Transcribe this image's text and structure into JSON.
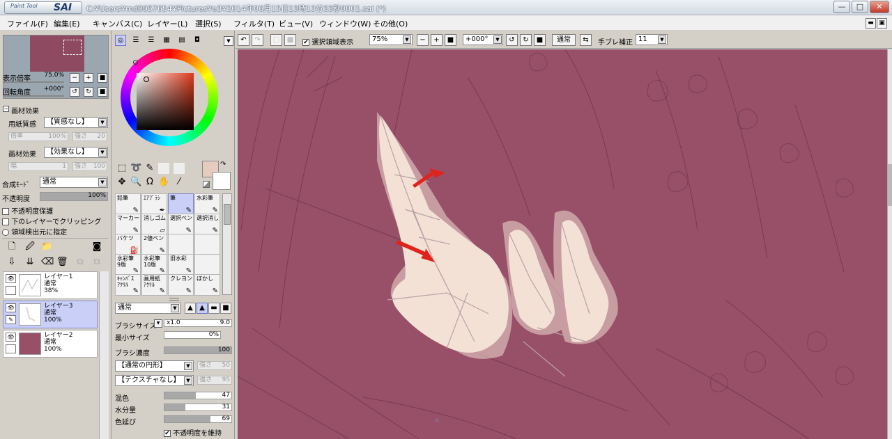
{
  "titlebar": {
    "logo_small": "Paint Tool",
    "logo_big": "SAI",
    "path": "C:¥Users¥md0057654¥Pictures¥e3¥2014年06月15日13時13分33秒0001.sai (*)",
    "min_label": "—",
    "max_label": "□",
    "close_label": "✕"
  },
  "menu": [
    "ファイル(F)",
    "編集(E)",
    "キャンバス(C)",
    "レイヤー(L)",
    "選択(S)",
    "フィルタ(T)",
    "ビュー(V)",
    "ウィンドウ(W)",
    "その他(O)"
  ],
  "mdi": [
    "▬",
    "▣",
    "✕"
  ],
  "navigator": {
    "zoom_label": "表示倍率",
    "zoom_value": "75.0%",
    "rotate_label": "回転角度",
    "rotate_value": "+000°"
  },
  "paper_effect": {
    "header": "画材効果",
    "texture_label": "用紙質感",
    "texture_value": "【質感なし】",
    "scale_label": "倍率",
    "scale_value": "100%",
    "strength_label": "強さ",
    "strength_value": "20",
    "effect_label": "画材効果",
    "effect_value": "【効果なし】",
    "width_label": "幅",
    "width_value": "1",
    "strength2_value": "100"
  },
  "layer_props": {
    "blend_label": "合成ﾓｰﾄﾞ",
    "blend_value": "通常",
    "opacity_label": "不透明度",
    "opacity_value": "100%",
    "opacity_fraction": 1.0,
    "preserve_opacity": "不透明度保護",
    "clip_label": "下のレイヤーでクリッピング",
    "selection_source": "領域検出元に指定"
  },
  "layers": [
    {
      "name": "レイヤー1",
      "mode": "通常",
      "opacity": "38%",
      "visible": true,
      "selected": false
    },
    {
      "name": "レイヤー3",
      "mode": "通常",
      "opacity": "100%",
      "visible": true,
      "selected": true
    },
    {
      "name": "レイヤー2",
      "mode": "通常",
      "opacity": "100%",
      "visible": true,
      "selected": false
    }
  ],
  "tools": [
    {
      "label": "鉛筆",
      "selected": false
    },
    {
      "label": "ｴｱﾌﾞﾗｼ",
      "selected": false
    },
    {
      "label": "筆",
      "selected": true
    },
    {
      "label": "水彩筆",
      "selected": false
    },
    {
      "label": "マーカー",
      "selected": false
    },
    {
      "label": "消しゴム",
      "selected": false
    },
    {
      "label": "選択ペン",
      "selected": false
    },
    {
      "label": "選択消し",
      "selected": false
    },
    {
      "label": "バケツ",
      "selected": false
    },
    {
      "label": "2値ペン",
      "selected": false
    },
    {
      "label": "",
      "selected": false
    },
    {
      "label": "",
      "selected": false
    },
    {
      "label": "水彩筆\n9版",
      "selected": false
    },
    {
      "label": "水彩筆\n10版",
      "selected": false
    },
    {
      "label": "旧水彩",
      "selected": false
    },
    {
      "label": "",
      "selected": false
    },
    {
      "label": "ｷｬﾝﾊﾞｽ\nｱｸﾘﾙ",
      "selected": false
    },
    {
      "label": "画用紙\nｱｸﾘﾙ",
      "selected": false
    },
    {
      "label": "クレヨン",
      "selected": false
    },
    {
      "label": "ぼかし",
      "selected": false
    }
  ],
  "brush": {
    "mode_value": "通常",
    "size_label": "ブラシサイズ",
    "size_mult": "x1.0",
    "size_value": "9.0",
    "min_size_label": "最小サイズ",
    "min_size_value": "0%",
    "density_label": "ブラシ濃度",
    "density_value": "100",
    "shape_value": "【通常の円形】",
    "shape_strength_label": "強さ",
    "shape_strength_value": "50",
    "texture_value": "【テクスチャなし】",
    "texture_strength_label": "強さ",
    "texture_strength_value": "95",
    "blend_label": "混色",
    "blend_value": "47",
    "blend_fraction": 0.47,
    "water_label": "水分量",
    "water_value": "31",
    "water_fraction": 0.31,
    "extend_label": "色延び",
    "extend_value": "69",
    "extend_fraction": 0.69,
    "keep_opacity_label": "不透明度を維持"
  },
  "colors": {
    "canvas": "#975068",
    "primary": "#e8cbbf",
    "secondary": "#ffffff",
    "accent_select": "#c9cff7",
    "arrow": "#e0241b"
  },
  "toolbar": {
    "show_selection_label": "選択領域表示",
    "zoom_value": "75%",
    "rotation_value": "+000°",
    "blend_mode": "通常",
    "stabilizer_label": "手ブレ補正",
    "stabilizer_value": "11"
  }
}
